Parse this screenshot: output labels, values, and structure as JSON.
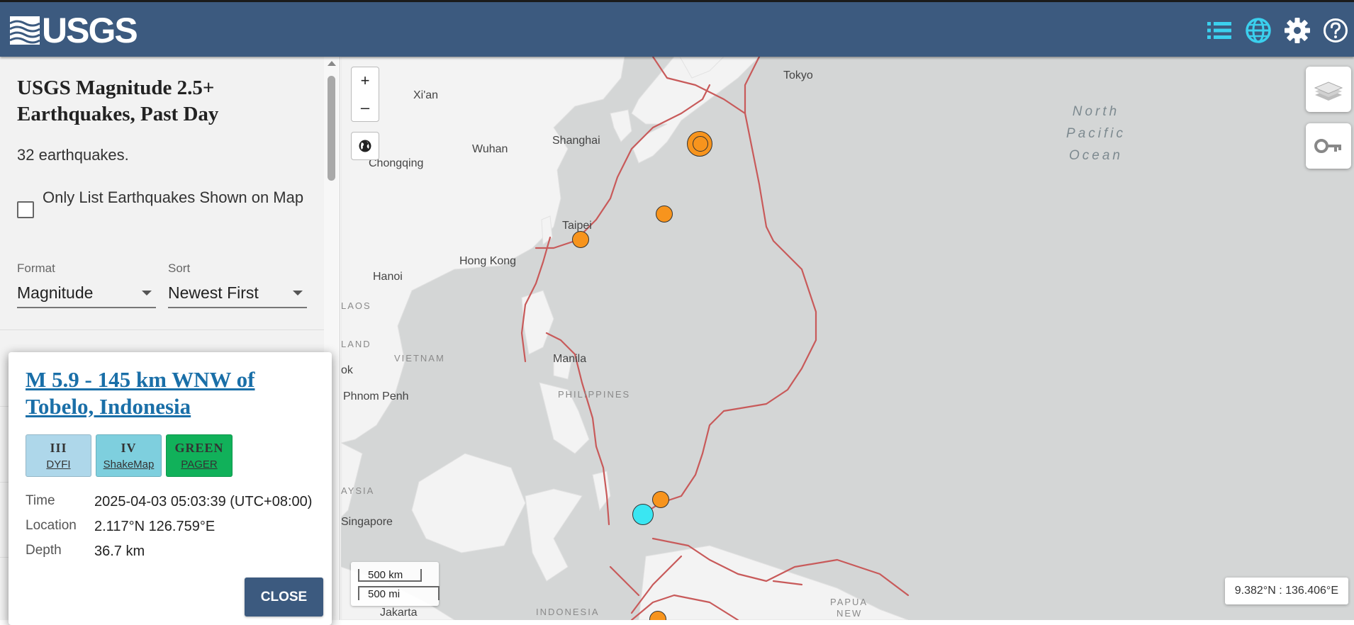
{
  "header": {
    "logo_text": "USGS",
    "icons": [
      "list-icon",
      "globe-icon",
      "gear-icon",
      "help-icon"
    ],
    "colors": {
      "bar": "#3c5a7f",
      "accent": "#3bd0ee"
    }
  },
  "sidebar": {
    "title": "USGS Magnitude 2.5+ Earthquakes, Past Day",
    "count": "32 earthquakes.",
    "only_list_label": "Only List Earthquakes Shown on Map",
    "format_label": "Format",
    "format_value": "Magnitude",
    "sort_label": "Sort",
    "sort_value": "Newest First"
  },
  "popup": {
    "title": "M 5.9 - 145 km WNW of Tobelo, Indonesia",
    "badges": [
      {
        "value": "III",
        "label": "DYFI",
        "color": "#aed7ea"
      },
      {
        "value": "IV",
        "label": "ShakeMap",
        "color": "#7ecfde"
      },
      {
        "value": "GREEN",
        "label": "PAGER",
        "color": "#11b15a"
      }
    ],
    "time_label": "Time",
    "time_value": "2025-04-03 05:03:39 (UTC+08:00)",
    "location_label": "Location",
    "location_value": "2.117°N 126.759°E",
    "depth_label": "Depth",
    "depth_value": "36.7 km",
    "close_label": "CLOSE"
  },
  "map": {
    "zoom_in": "+",
    "zoom_out": "–",
    "places": {
      "tokyo": "Tokyo",
      "xian": "Xi'an",
      "wuhan": "Wuhan",
      "shanghai": "Shanghai",
      "chongqing": "Chongqing",
      "taipei": "Taipei",
      "hongkong": "Hong Kong",
      "hanoi": "Hanoi",
      "manila": "Manila",
      "phnompenh": "Phnom Penh",
      "singapore": "Singapore",
      "jakarta": "Jakarta",
      "bangkok": "ok"
    },
    "countries": {
      "laos": "LAOS",
      "thailand": "LAND",
      "vietnam": "VIETNAM",
      "philippines": "PHILIPPINES",
      "malaysia": "AYSIA",
      "indonesia": "INDONESIA",
      "papua": "PAPUA",
      "newg": "NEW"
    },
    "ocean_lines": [
      "North",
      "Pacific",
      "Ocean"
    ],
    "scale_km": "500 km",
    "scale_mi": "500 mi",
    "coords": "9.382°N : 136.406°E",
    "colors": {
      "water": "#d4d6d6",
      "land": "#f3f3f3",
      "plate": "#c85a5a",
      "quake_old": "#f7941d",
      "quake_new": "#3ae6f2"
    }
  }
}
